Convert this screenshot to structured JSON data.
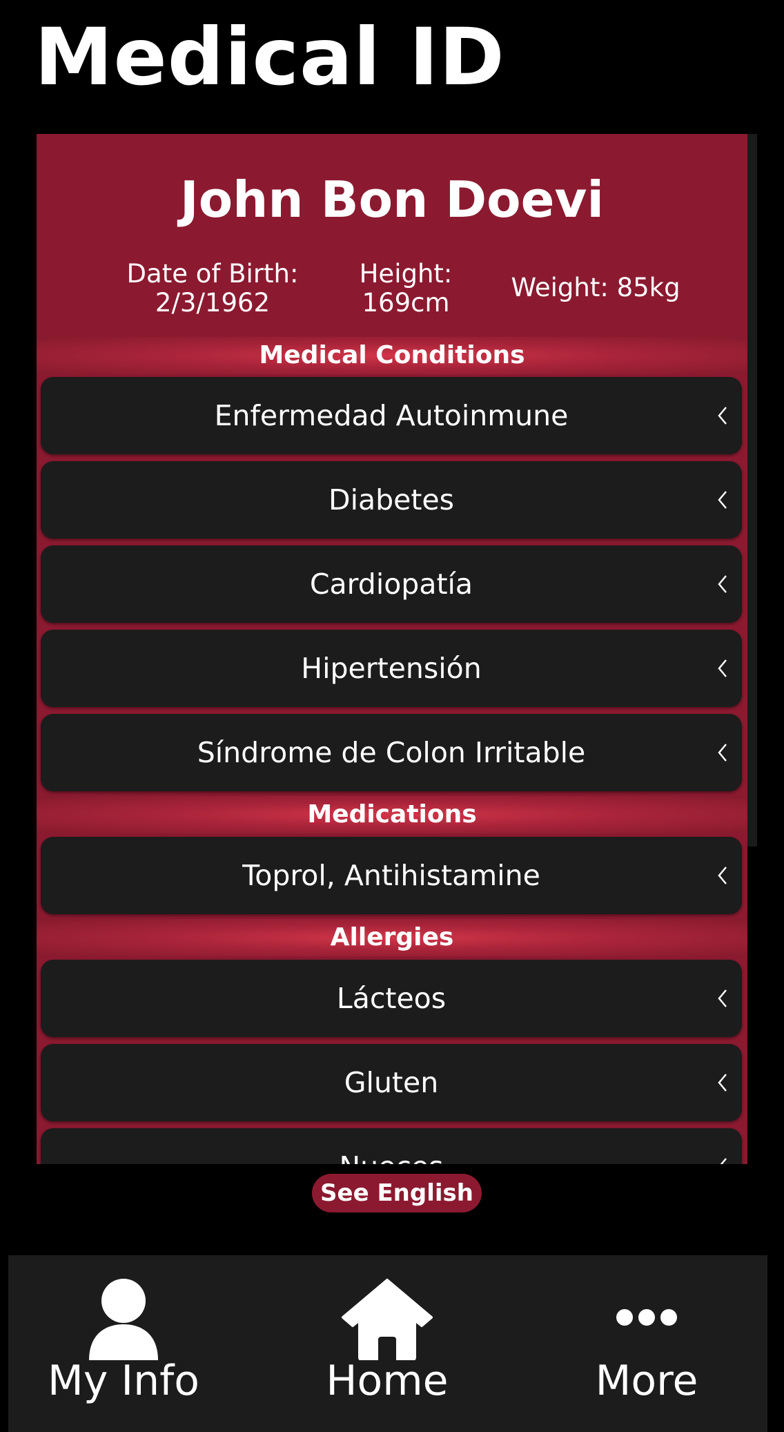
{
  "header": {
    "title": "Medical ID"
  },
  "profile": {
    "name": "John Bon Doevi",
    "dob_label": "Date of Birth:",
    "dob_value": "2/3/1962",
    "height_label": "Height:",
    "height_value": "169cm",
    "weight": "Weight: 85kg"
  },
  "sections": {
    "conditions": {
      "title": "Medical Conditions",
      "items": [
        "Enfermedad Autoinmune",
        "Diabetes",
        "Cardiopatía",
        "Hipertensión",
        "Síndrome de Colon Irritable"
      ]
    },
    "medications": {
      "title": "Medications",
      "items": [
        "Toprol, Antihistamine"
      ]
    },
    "allergies": {
      "title": "Allergies",
      "items": [
        "Lácteos",
        "Gluten",
        "Nueces"
      ]
    }
  },
  "actions": {
    "see_english": "See English"
  },
  "tabbar": {
    "my_info": "My Info",
    "home": "Home",
    "more": "More"
  },
  "colors": {
    "accent": "#8b1a30",
    "section_highlight": "#d23548",
    "row_bg": "#1c1c1c",
    "background": "#000000"
  },
  "icons": {
    "row": "chevron-left-icon",
    "my_info": "person-icon",
    "home": "house-icon",
    "more": "ellipsis-icon"
  }
}
